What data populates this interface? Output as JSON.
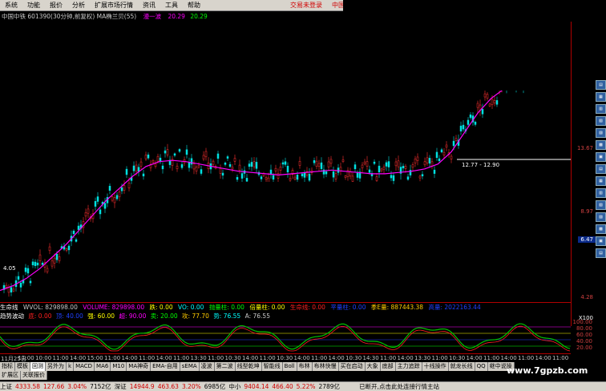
{
  "menu": {
    "items": [
      "系统",
      "功能",
      "报价",
      "分析",
      "扩展市场行情",
      "资讯",
      "工具",
      "帮助"
    ],
    "right_items": [
      "交易未登录",
      "中国中"
    ]
  },
  "header": {
    "title": "中国中铁 601390(30分钟,前复权) MA椭兰贝(55)",
    "ma_label": "漫一波",
    "ma_v1": "20.29",
    "ma_v2": "20.29"
  },
  "yaxis": {
    "ticks": [
      "13.67",
      "8.97",
      "4.28"
    ],
    "highlight": "6.47",
    "left_low": "4.05",
    "range_label": "12.77 - 12.90"
  },
  "volrow": {
    "title": "生命线",
    "items": [
      {
        "label": "WVOL: 829898.00",
        "color": "#c8c8c8"
      },
      {
        "label": "VOLUME: 829898.00",
        "color": "#ff00ff"
      },
      {
        "label": "跌: 0.00",
        "color": "#ffff00"
      },
      {
        "label": "VO: 0.00",
        "color": "#00ffff"
      },
      {
        "label": "抛量柱: 0.00",
        "color": "#00ff00"
      },
      {
        "label": "倍量柱: 0.00",
        "color": "#ffff00"
      },
      {
        "label": "生命线: 0.00",
        "color": "#ff2020"
      },
      {
        "label": "平量柱: 0.00",
        "color": "#2040ff"
      },
      {
        "label": "季E量: 887443.38",
        "color": "#ffcc00"
      },
      {
        "label": "高量: 2022163.44",
        "color": "#2040ff"
      }
    ],
    "scale": "X100"
  },
  "trendrow": {
    "title": "趋势波动",
    "items": [
      {
        "label": "底: 0.00",
        "color": "#ff2020"
      },
      {
        "label": "顶: 40.00",
        "color": "#2040ff"
      },
      {
        "label": "强: 60.00",
        "color": "#ffff00"
      },
      {
        "label": "超: 90.00",
        "color": "#ff00ff"
      },
      {
        "label": "卖: 20.00",
        "color": "#00ff00"
      },
      {
        "label": "攻: 77.70",
        "color": "#ffcc00"
      },
      {
        "label": "势: 76.55",
        "color": "#00ffff"
      },
      {
        "label": "A: 76.55",
        "color": "#c8c8c8"
      }
    ],
    "scale": [
      "100.00",
      "80.00",
      "60.00",
      "40.00",
      "20.00"
    ]
  },
  "timeaxis": {
    "labels": [
      "11月25日",
      "11:00",
      "10:00",
      "11:00",
      "14:00",
      "15:00",
      "11:00",
      "14:00",
      "11:00",
      "14:00",
      "11:00",
      "13:30",
      "11:00",
      "10:30",
      "14:00",
      "11:00",
      "10:30",
      "14:00",
      "11:00",
      "14:00",
      "10:30",
      "14:30",
      "11:00",
      "14:00",
      "13:30",
      "11:00",
      "10:30",
      "14:00",
      "11:00",
      "14:00",
      "11:00",
      "14:00",
      "11:00"
    ]
  },
  "tabs": {
    "row1": [
      "指标",
      "模板",
      "回测",
      "另外为",
      "k",
      "MACD",
      "MA6",
      "M10",
      "MA神奇",
      "EMA-自用",
      "sEMA",
      "凌波",
      "第二波",
      "线型乾坤",
      "智能线",
      "Boll",
      "布林",
      "布林快慢",
      "买在启动",
      "大象",
      "底部",
      "主力追踪",
      "十线操作",
      "就龙长线",
      "QQ",
      "继中说操"
    ],
    "active": "回测",
    "row2": [
      "扩展区",
      "关联报价"
    ]
  },
  "status": {
    "sh": "上证",
    "sh_v": "4333.58",
    "sh_c": "127.66",
    "sh_p": "3.04%",
    "sh_amt": "7152亿",
    "sz": "深证",
    "sz_v": "14944.9",
    "sz_c": "463.63",
    "sz_p": "3.20%",
    "sz_amt": "6985亿",
    "zx": "中小",
    "zx_v": "9404.14",
    "zx_c": "466.40",
    "zx_p": "5.22%",
    "zx_amt": "2789亿",
    "msg": "已断开,点击此处连接行情主站"
  },
  "watermark": "www.7gpzb.com",
  "chart_data": {
    "type": "line",
    "title": "中国中铁 601390(30分钟,前复权)",
    "ylim": [
      4.28,
      14.5
    ],
    "series": [
      {
        "name": "MA",
        "values": [
          4.1,
          4.3,
          4.6,
          5.0,
          5.5,
          6.0,
          6.6,
          7.2,
          7.8,
          8.3,
          8.8,
          9.2,
          9.4,
          9.45,
          9.4,
          9.3,
          9.2,
          9.1,
          9.0,
          8.95,
          8.9,
          8.85,
          8.9,
          8.95,
          9.0,
          9.05,
          9.0,
          8.95,
          8.9,
          8.9,
          8.95,
          9.0,
          9.1,
          9.3,
          9.8,
          10.6,
          11.4,
          12.0,
          12.4,
          12.6,
          12.8,
          13.3,
          14.0,
          14.5
        ]
      }
    ]
  }
}
